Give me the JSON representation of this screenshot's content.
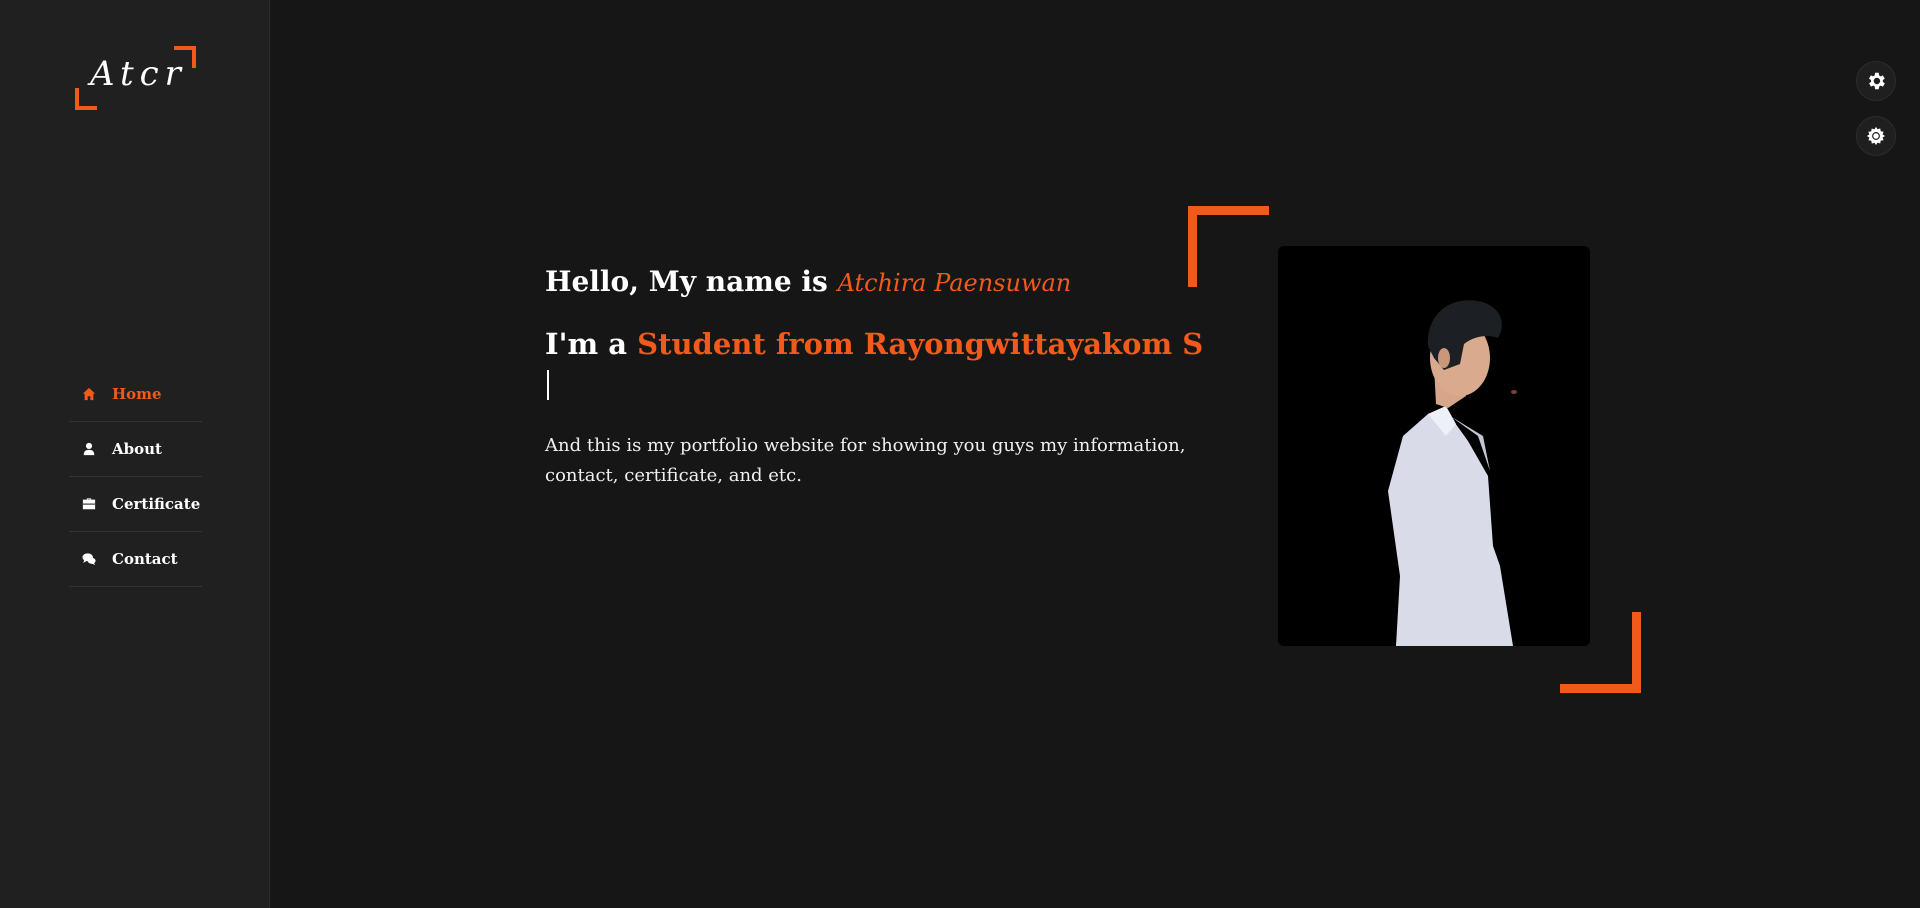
{
  "sidebar": {
    "logo_text": "Atcr",
    "nav": [
      {
        "label": "Home",
        "icon": "home-icon",
        "active": true
      },
      {
        "label": "About",
        "icon": "user-icon",
        "active": false
      },
      {
        "label": "Certificate",
        "icon": "briefcase-icon",
        "active": false
      },
      {
        "label": "Contact",
        "icon": "chat-icon",
        "active": false
      }
    ]
  },
  "toolbar": {
    "buttons": [
      "gear-icon",
      "sun-gear-icon"
    ]
  },
  "hero": {
    "greeting_prefix": "Hello, My name is",
    "name": "Atchira Paensuwan",
    "role_prefix": "I'm a",
    "role_value": "Student from Rayongwittayakom S",
    "description": "And this is my portfolio website for showing you guys my information, contact, certificate, and etc."
  },
  "colors": {
    "accent": "#f15a1b",
    "background": "#161616",
    "sidebar": "#202020"
  }
}
